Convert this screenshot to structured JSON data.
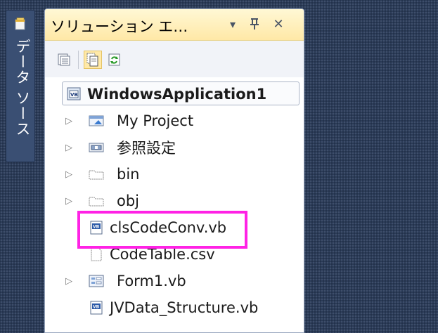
{
  "side_tab": {
    "label": "データ ソース",
    "icon": "document-icon"
  },
  "panel": {
    "title": "ソリューション エ…",
    "title_buttons": [
      {
        "name": "dropdown",
        "glyph": "▾"
      },
      {
        "name": "pin",
        "glyph": "ᅟ"
      },
      {
        "name": "close",
        "glyph": "✕"
      }
    ]
  },
  "toolbar": {
    "tools": [
      {
        "name": "properties-icon",
        "active": false
      },
      {
        "name": "show-all-files-icon",
        "active": true
      },
      {
        "name": "refresh-icon",
        "active": false
      }
    ]
  },
  "tree": {
    "root": {
      "label": "WindowsApplication1",
      "icon": "vb-project-icon"
    },
    "items": [
      {
        "label": "My Project",
        "icon": "my-project-icon",
        "expandable": true
      },
      {
        "label": "参照設定",
        "icon": "references-icon",
        "expandable": true
      },
      {
        "label": "bin",
        "icon": "folder-icon",
        "expandable": true
      },
      {
        "label": "obj",
        "icon": "folder-icon",
        "expandable": true
      },
      {
        "label": "clsCodeConv.vb",
        "icon": "vb-file-icon",
        "expandable": false,
        "highlighted": true
      },
      {
        "label": "CodeTable.csv",
        "icon": "file-icon",
        "expandable": false
      },
      {
        "label": "Form1.vb",
        "icon": "form-icon",
        "expandable": true
      },
      {
        "label": "JVData_Structure.vb",
        "icon": "vb-file-icon",
        "expandable": false
      }
    ]
  },
  "colors": {
    "highlight": "#ff22e5",
    "title_bar": "#ffe8a6",
    "background": "#2b3c59"
  }
}
